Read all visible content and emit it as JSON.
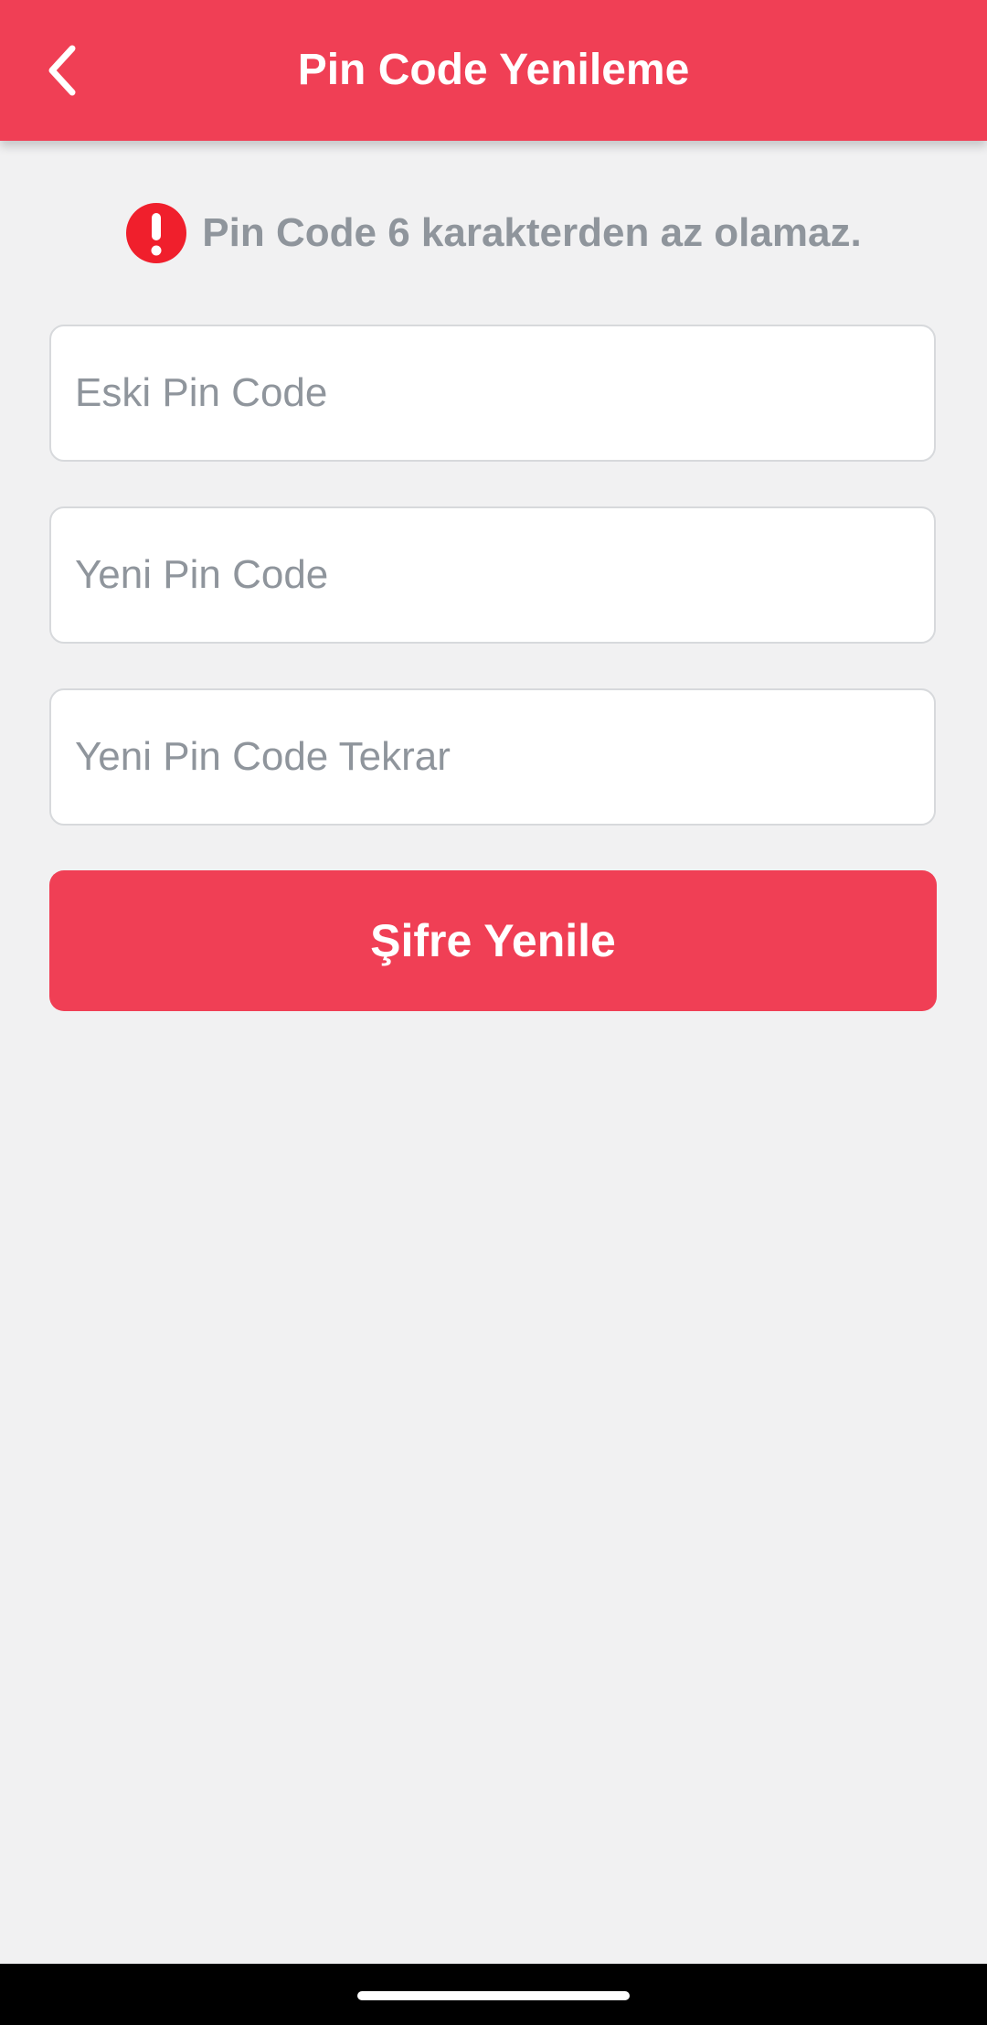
{
  "header": {
    "title": "Pin Code Yenileme",
    "back_icon": "chevron-left-icon"
  },
  "notice": {
    "icon": "exclamation-circle-icon",
    "icon_color": "#f01f2c",
    "text": "Pin Code 6 karakterden az olamaz."
  },
  "form": {
    "old_pin": {
      "placeholder": "Eski Pin Code",
      "value": ""
    },
    "new_pin": {
      "placeholder": "Yeni Pin Code",
      "value": ""
    },
    "new_pin_repeat": {
      "placeholder": "Yeni Pin Code Tekrar",
      "value": ""
    },
    "submit_label": "Şifre Yenile"
  },
  "colors": {
    "accent": "#f03f55",
    "background": "#f1f1f2",
    "muted_text": "#8f959c"
  }
}
